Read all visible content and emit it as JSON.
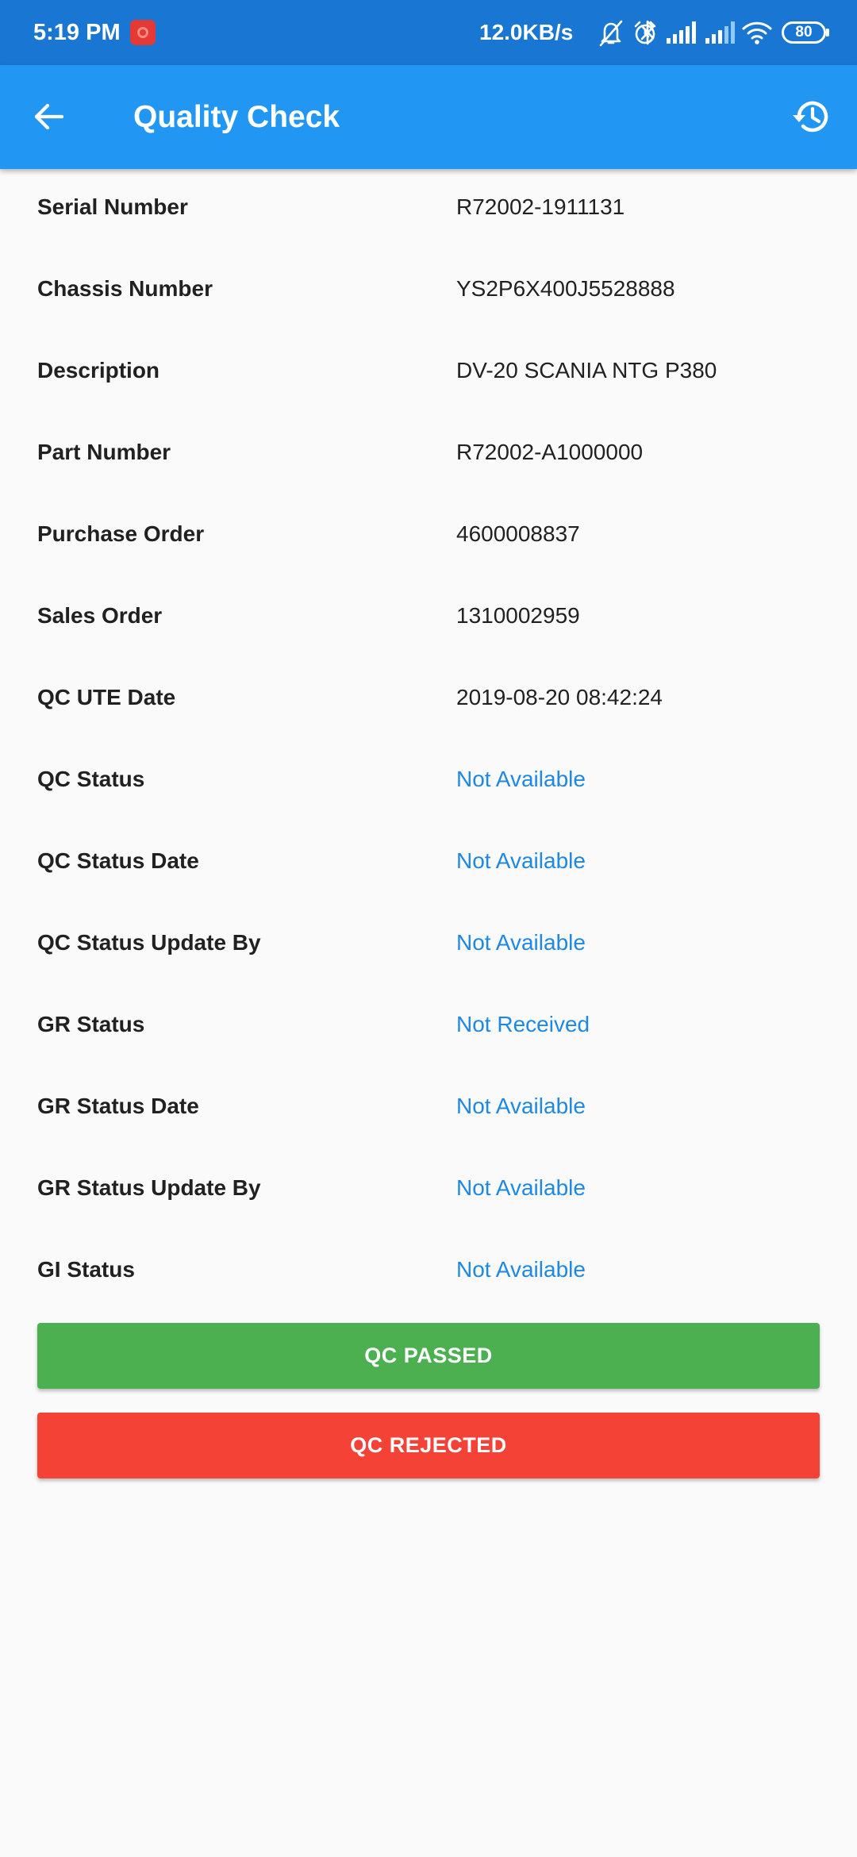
{
  "status_bar": {
    "time": "5:19 PM",
    "network_speed": "12.0KB/s",
    "battery": "80"
  },
  "app_bar": {
    "title": "Quality Check",
    "back_icon": "arrow-back-icon",
    "history_icon": "history-icon"
  },
  "details": [
    {
      "label": "Serial Number",
      "value": "R72002-1911131"
    },
    {
      "label": "Chassis Number",
      "value": "YS2P6X400J5528888"
    },
    {
      "label": "Description",
      "value": "DV-20 SCANIA NTG P380"
    },
    {
      "label": "Part Number",
      "value": "R72002-A1000000"
    },
    {
      "label": "Purchase Order",
      "value": "4600008837"
    },
    {
      "label": "Sales Order",
      "value": "1310002959"
    },
    {
      "label": "QC UTE Date",
      "value": "2019-08-20 08:42:24"
    },
    {
      "label": "QC Status",
      "value": "Not Available"
    },
    {
      "label": "QC Status Date",
      "value": "Not Available"
    },
    {
      "label": "QC Status Update By",
      "value": "Not Available"
    },
    {
      "label": "GR Status",
      "value": "Not Received"
    },
    {
      "label": "GR Status Date",
      "value": "Not Available"
    },
    {
      "label": "GR Status Update By",
      "value": "Not Available"
    },
    {
      "label": "GI Status",
      "value": "Not Available"
    }
  ],
  "actions": {
    "passed_label": "QC PASSED",
    "rejected_label": "QC REJECTED"
  },
  "colors": {
    "status_bar": "#1976d2",
    "app_bar": "#2196f3",
    "highlight_value": "#1e88e5",
    "passed": "#4caf50",
    "rejected": "#f44336"
  }
}
